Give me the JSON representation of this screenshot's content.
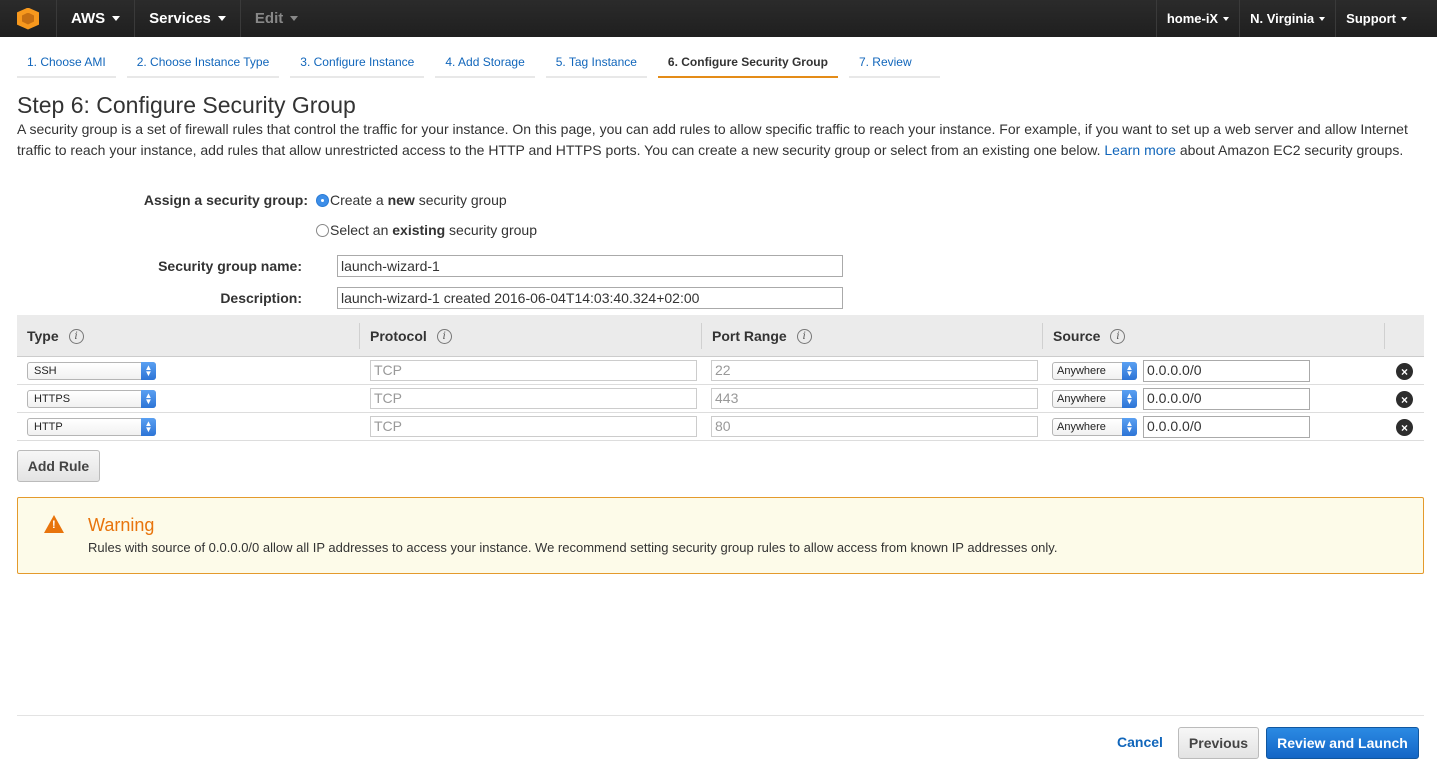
{
  "nav": {
    "brand": "AWS",
    "services": "Services",
    "edit": "Edit",
    "account": "home-iX",
    "region": "N. Virginia",
    "support": "Support"
  },
  "tabs": [
    {
      "label": "1. Choose AMI"
    },
    {
      "label": "2. Choose Instance Type"
    },
    {
      "label": "3. Configure Instance"
    },
    {
      "label": "4. Add Storage"
    },
    {
      "label": "5. Tag Instance"
    },
    {
      "label": "6. Configure Security Group",
      "active": true
    },
    {
      "label": "7. Review"
    }
  ],
  "page": {
    "title": "Step 6: Configure Security Group",
    "intro_before_link": "A security group is a set of firewall rules that control the traffic for your instance. On this page, you can add rules to allow specific traffic to reach your instance. For example, if you want to set up a web server and allow Internet traffic to reach your instance, add rules that allow unrestricted access to the HTTP and HTTPS ports. You can create a new security group or select from an existing one below.",
    "learn_more": "Learn more",
    "intro_after_link": "about Amazon EC2 security groups."
  },
  "assign": {
    "label": "Assign a security group:",
    "option_new_prefix": "Create a ",
    "option_new_bold": "new",
    "option_new_suffix": " security group",
    "option_existing_prefix": "Select an ",
    "option_existing_bold": "existing",
    "option_existing_suffix": " security group",
    "selected": "new"
  },
  "form": {
    "name_label": "Security group name:",
    "name_value": "launch-wizard-1",
    "desc_label": "Description:",
    "desc_value": "launch-wizard-1 created 2016-06-04T14:03:40.324+02:00"
  },
  "table": {
    "headers": {
      "type": "Type",
      "protocol": "Protocol",
      "port_range": "Port Range",
      "source": "Source"
    },
    "rules": [
      {
        "type": "SSH",
        "protocol": "TCP",
        "port": "22",
        "source": "Anywhere",
        "cidr": "0.0.0.0/0"
      },
      {
        "type": "HTTPS",
        "protocol": "TCP",
        "port": "443",
        "source": "Anywhere",
        "cidr": "0.0.0.0/0"
      },
      {
        "type": "HTTP",
        "protocol": "TCP",
        "port": "80",
        "source": "Anywhere",
        "cidr": "0.0.0.0/0"
      }
    ]
  },
  "add_rule": "Add Rule",
  "warning": {
    "title": "Warning",
    "text": "Rules with source of 0.0.0.0/0 allow all IP addresses to access your instance. We recommend setting security group rules to allow access from known IP addresses only."
  },
  "footer": {
    "cancel": "Cancel",
    "previous": "Previous",
    "review_launch": "Review and Launch"
  },
  "colors": {
    "accent": "#1166bb",
    "active_tab_underline": "#e48c18",
    "warning": "#e8740c",
    "primary_button": "#1466c6"
  }
}
